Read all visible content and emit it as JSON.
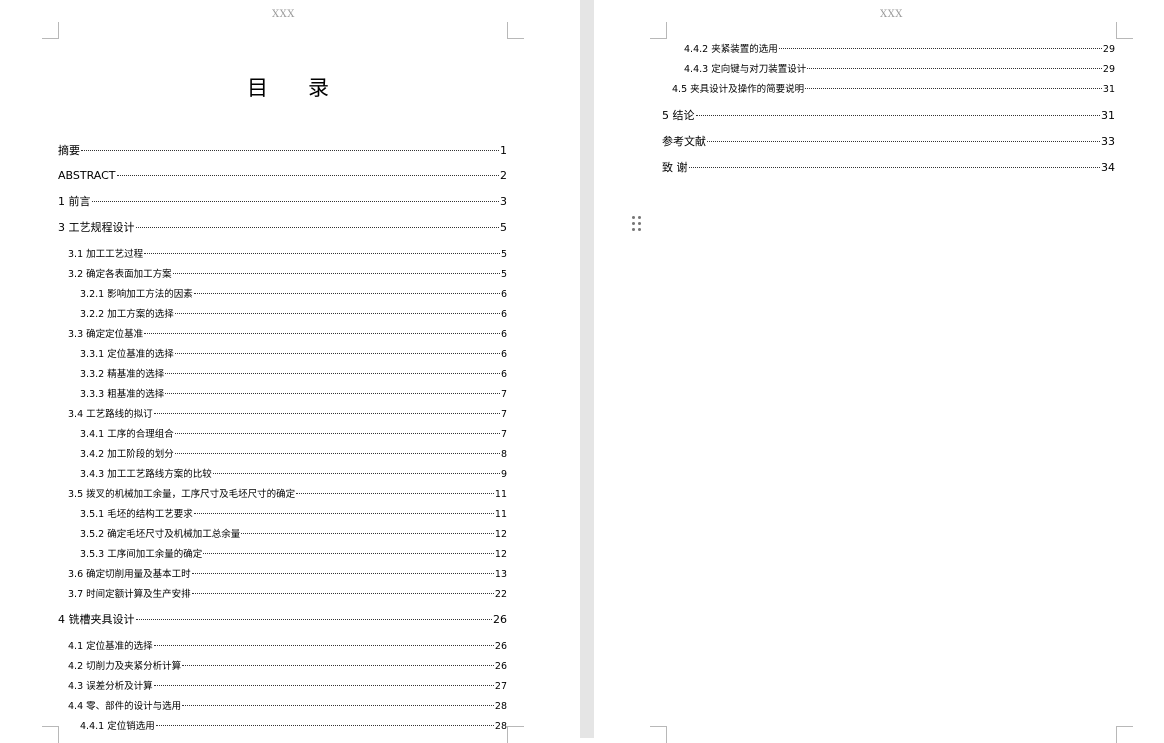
{
  "header": {
    "left": "XXX",
    "right": "XXX"
  },
  "toc_title": "目录",
  "left_entries": [
    {
      "level": 0,
      "label": "摘要",
      "page": "1"
    },
    {
      "level": 0,
      "label": "ABSTRACT",
      "page": "2"
    },
    {
      "level": 0,
      "label": "1   前言",
      "page": "3"
    },
    {
      "level": 0,
      "label": "3   工艺规程设计",
      "page": "5"
    },
    {
      "level": 1,
      "label": "3.1  加工工艺过程",
      "page": "5"
    },
    {
      "level": 1,
      "label": "3.2  确定各表面加工方案",
      "page": "5"
    },
    {
      "level": 2,
      "label": "3.2.1   影响加工方法的因素",
      "page": "6"
    },
    {
      "level": 2,
      "label": "3.2.2   加工方案的选择",
      "page": "6"
    },
    {
      "level": 1,
      "label": "3.3  确定定位基准",
      "page": "6"
    },
    {
      "level": 2,
      "label": "3.3.1   定位基准的选择",
      "page": "6"
    },
    {
      "level": 2,
      "label": "3.3.2   精基准的选择",
      "page": "6"
    },
    {
      "level": 2,
      "label": "3.3.3   粗基准的选择",
      "page": "7"
    },
    {
      "level": 1,
      "label": "3.4  工艺路线的拟订",
      "page": "7"
    },
    {
      "level": 2,
      "label": "3.4.1   工序的合理组合",
      "page": "7"
    },
    {
      "level": 2,
      "label": "3.4.2   加工阶段的划分",
      "page": "8"
    },
    {
      "level": 2,
      "label": "3.4.3   加工工艺路线方案的比较",
      "page": "9"
    },
    {
      "level": 1,
      "label": "3.5  拨叉的机械加工余量，工序尺寸及毛坯尺寸的确定",
      "page": "11"
    },
    {
      "level": 2,
      "label": "3.5.1   毛坯的结构工艺要求",
      "page": "11"
    },
    {
      "level": 2,
      "label": "3.5.2   确定毛坯尺寸及机械加工总余量",
      "page": "12"
    },
    {
      "level": 2,
      "label": "3.5.3   工序间加工余量的确定",
      "page": "12"
    },
    {
      "level": 1,
      "label": "3.6  确定切削用量及基本工时",
      "page": "13"
    },
    {
      "level": 1,
      "label": "3.7  时间定额计算及生产安排",
      "page": "22"
    },
    {
      "level": 0,
      "label": "4   铣槽夹具设计",
      "page": "26"
    },
    {
      "level": 1,
      "label": "4.1  定位基准的选择",
      "page": "26"
    },
    {
      "level": 1,
      "label": "4.2  切削力及夹紧分析计算",
      "page": "26"
    },
    {
      "level": 1,
      "label": "4.3  误差分析及计算",
      "page": "27"
    },
    {
      "level": 1,
      "label": "4.4  零、部件的设计与选用",
      "page": "28"
    },
    {
      "level": 2,
      "label": "4.4.1   定位销选用",
      "page": "28"
    }
  ],
  "right_entries": [
    {
      "level": 2,
      "label": "4.4.2   夹紧装置的选用",
      "page": "29"
    },
    {
      "level": 2,
      "label": "4.4.3   定向键与对刀装置设计",
      "page": "29"
    },
    {
      "level": 1,
      "label": "4.5  夹具设计及操作的简要说明",
      "page": "31"
    },
    {
      "level": 0,
      "label": "5   结论",
      "page": "31"
    },
    {
      "level": 0,
      "label": "参考文献",
      "page": "33"
    },
    {
      "level": 0,
      "label": "致      谢",
      "page": "34"
    }
  ],
  "icons": {
    "drag_handle": "drag-handle-icon"
  }
}
